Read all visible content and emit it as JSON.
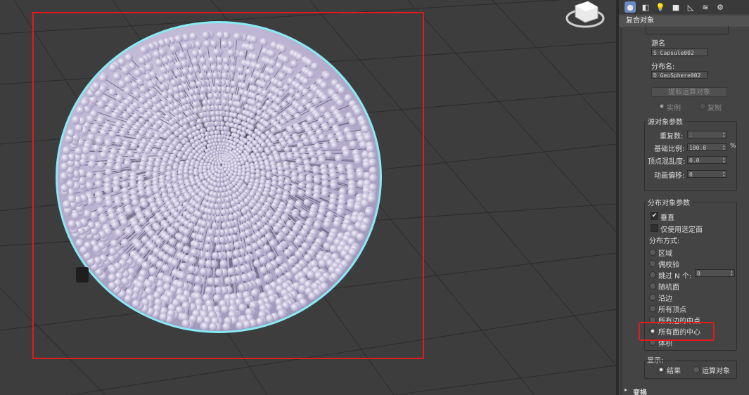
{
  "tabs": [
    {
      "name": "geometry-tab-icon",
      "glyph": "●",
      "active": true
    },
    {
      "name": "shapes-tab-icon",
      "glyph": "◧"
    },
    {
      "name": "lights-tab-icon",
      "glyph": "💡"
    },
    {
      "name": "cameras-tab-icon",
      "glyph": "■"
    },
    {
      "name": "helpers-tab-icon",
      "glyph": "◺"
    },
    {
      "name": "spacewarps-tab-icon",
      "glyph": "≋"
    },
    {
      "name": "systems-tab-icon",
      "glyph": "⚙"
    }
  ],
  "category": "复合对象",
  "pick": {
    "source_label": "源名",
    "source_value": "S_Capsule002",
    "dist_label": "分布名:",
    "dist_value": "D_GeoSphere002",
    "extract_button": "提取运算对象",
    "instance_label": "实例",
    "copy_label": "复制"
  },
  "source_params": {
    "title": "源对象参数",
    "duplicates_label": "重复数:",
    "duplicates_value": "1",
    "base_scale_label": "基础比例:",
    "base_scale_value": "100.0",
    "base_scale_unit": "%",
    "vertex_chaos_label": "顶点混乱度:",
    "vertex_chaos_value": "0.0",
    "anim_offset_label": "动画偏移:",
    "anim_offset_value": "0"
  },
  "dist_params": {
    "title": "分布对象参数",
    "perpendicular_label": "垂直",
    "use_selected_label": "仅使用选定面",
    "method_label": "分布方式:",
    "options": [
      "区域",
      "偶校验",
      "跳过 N 个:",
      "随机面",
      "沿边",
      "所有顶点",
      "所有边的中点",
      "所有面的中心",
      "体积"
    ],
    "skip_n_value": "0",
    "selected_index": 7
  },
  "display": {
    "title": "显示:",
    "result_label": "结果",
    "operands_label": "运算对象"
  },
  "transform_rollout": "变换"
}
